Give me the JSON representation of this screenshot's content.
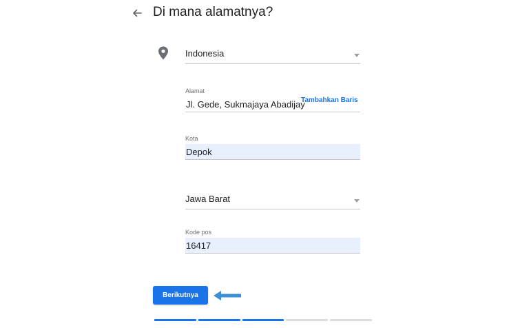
{
  "header": {
    "title": "Di mana alamatnya?"
  },
  "country": {
    "value": "Indonesia"
  },
  "address": {
    "label": "Alamat",
    "value": "Jl. Gede, Sukmajaya Abadijay",
    "add_line_label": "Tambahkan Baris"
  },
  "city": {
    "label": "Kota",
    "value": "Depok"
  },
  "province": {
    "value": "Jawa Barat"
  },
  "postal": {
    "label": "Kode pos",
    "value": "16417"
  },
  "actions": {
    "next_label": "Berikutnya"
  },
  "progress": {
    "completed_steps": 3,
    "total_steps": 5
  },
  "colors": {
    "accent": "#1a73e8",
    "autofill": "#e8f0fe",
    "pointer_arrow": "#3b8fd4"
  }
}
